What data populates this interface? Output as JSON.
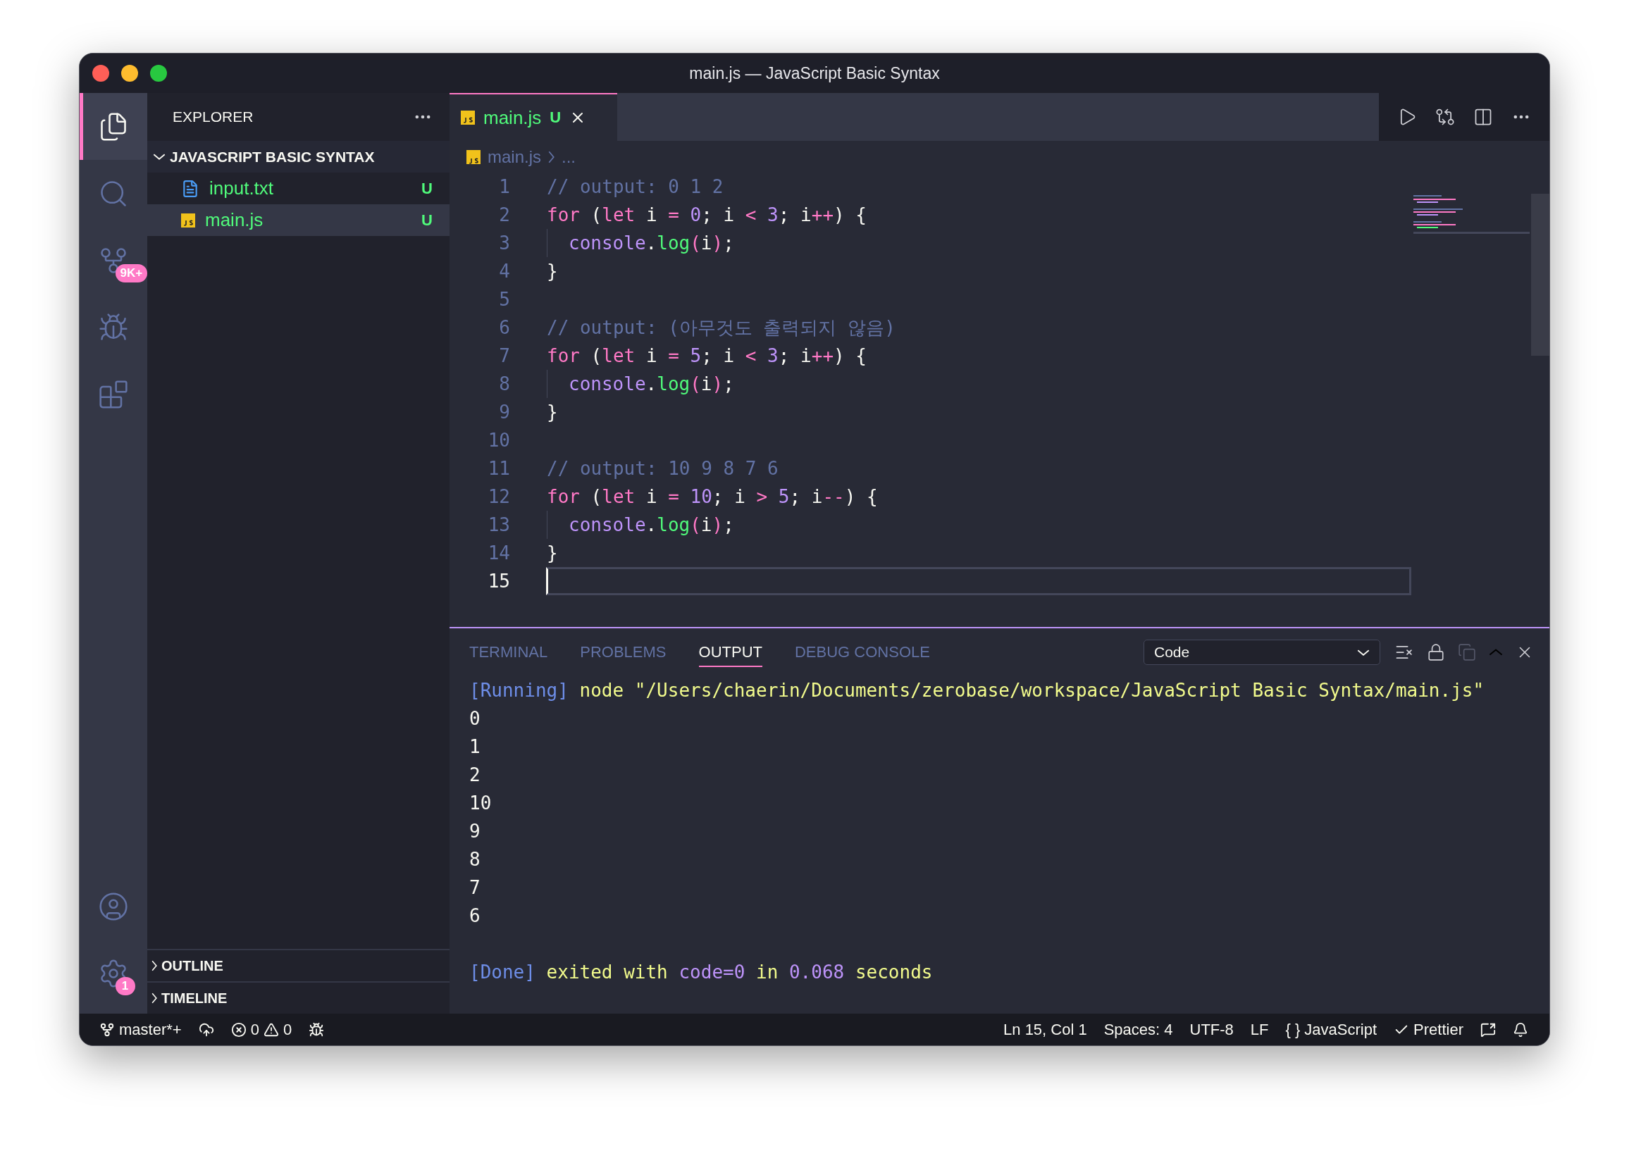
{
  "window": {
    "title": "main.js — JavaScript Basic Syntax"
  },
  "activity_bar": {
    "top": [
      {
        "kind": "files",
        "selected": true
      },
      {
        "kind": "search",
        "selected": false
      },
      {
        "kind": "source-control",
        "selected": false,
        "badge": "9K+"
      },
      {
        "kind": "run-debug",
        "selected": false
      },
      {
        "kind": "extensions",
        "selected": false
      }
    ],
    "bottom": [
      {
        "kind": "account",
        "selected": false
      },
      {
        "kind": "settings",
        "selected": false,
        "badge": "1"
      }
    ]
  },
  "sidebar": {
    "title": "EXPLORER",
    "folder": {
      "name": "JAVASCRIPT BASIC SYNTAX",
      "expanded": true,
      "files": [
        {
          "name": "input.txt",
          "kind": "text",
          "status": "U",
          "selected": false
        },
        {
          "name": "main.js",
          "kind": "js",
          "status": "U",
          "selected": true
        }
      ]
    },
    "sections": [
      {
        "name": "OUTLINE",
        "expanded": false
      },
      {
        "name": "TIMELINE",
        "expanded": false
      }
    ]
  },
  "tabs": [
    {
      "name": "main.js",
      "status": "U",
      "selected": true
    }
  ],
  "breadcrumb": {
    "file": "main.js",
    "rest": "..."
  },
  "code": [
    {
      "number": "1",
      "tokens": [
        {
          "t": "// output: 0 1 2",
          "kind": "comment"
        }
      ]
    },
    {
      "number": "2",
      "tokens": [
        {
          "t": "for",
          "kind": "keyword"
        },
        {
          "t": " (",
          "kind": "plain"
        },
        {
          "t": "let",
          "kind": "keyword"
        },
        {
          "t": " i ",
          "kind": "plain"
        },
        {
          "t": "=",
          "kind": "operator"
        },
        {
          "t": " 0",
          "kind": "number"
        },
        {
          "t": "; i ",
          "kind": "plain"
        },
        {
          "t": "<",
          "kind": "operator"
        },
        {
          "t": " 3",
          "kind": "number"
        },
        {
          "t": "; i",
          "kind": "plain"
        },
        {
          "t": "++",
          "kind": "operator"
        },
        {
          "t": ") {",
          "kind": "plain"
        }
      ]
    },
    {
      "number": "3",
      "indented": true,
      "tokens": [
        {
          "t": "console",
          "kind": "object"
        },
        {
          "t": ".",
          "kind": "plain"
        },
        {
          "t": "log",
          "kind": "function"
        },
        {
          "t": "(",
          "kind": "operator"
        },
        {
          "t": "i",
          "kind": "plain"
        },
        {
          "t": ")",
          "kind": "operator"
        },
        {
          "t": ";",
          "kind": "plain"
        }
      ]
    },
    {
      "number": "4",
      "tokens": [
        {
          "t": "}",
          "kind": "plain"
        }
      ]
    },
    {
      "number": "5"
    },
    {
      "number": "6",
      "tokens": [
        {
          "t": "// output: (아무것도 출력되지 않음)",
          "kind": "comment"
        }
      ]
    },
    {
      "number": "7",
      "tokens": [
        {
          "t": "for",
          "kind": "keyword"
        },
        {
          "t": " (",
          "kind": "plain"
        },
        {
          "t": "let",
          "kind": "keyword"
        },
        {
          "t": " i ",
          "kind": "plain"
        },
        {
          "t": "=",
          "kind": "operator"
        },
        {
          "t": " 5",
          "kind": "number"
        },
        {
          "t": "; i ",
          "kind": "plain"
        },
        {
          "t": "<",
          "kind": "operator"
        },
        {
          "t": " 3",
          "kind": "number"
        },
        {
          "t": "; i",
          "kind": "plain"
        },
        {
          "t": "++",
          "kind": "operator"
        },
        {
          "t": ") {",
          "kind": "plain"
        }
      ]
    },
    {
      "number": "8",
      "indented": true,
      "tokens": [
        {
          "t": "console",
          "kind": "object"
        },
        {
          "t": ".",
          "kind": "plain"
        },
        {
          "t": "log",
          "kind": "function"
        },
        {
          "t": "(",
          "kind": "operator"
        },
        {
          "t": "i",
          "kind": "plain"
        },
        {
          "t": ")",
          "kind": "operator"
        },
        {
          "t": ";",
          "kind": "plain"
        }
      ]
    },
    {
      "number": "9",
      "tokens": [
        {
          "t": "}",
          "kind": "plain"
        }
      ]
    },
    {
      "number": "10"
    },
    {
      "number": "11",
      "tokens": [
        {
          "t": "// output: 10 9 8 7 6",
          "kind": "comment"
        }
      ]
    },
    {
      "number": "12",
      "tokens": [
        {
          "t": "for",
          "kind": "keyword"
        },
        {
          "t": " (",
          "kind": "plain"
        },
        {
          "t": "let",
          "kind": "keyword"
        },
        {
          "t": " i ",
          "kind": "plain"
        },
        {
          "t": "=",
          "kind": "operator"
        },
        {
          "t": " 10",
          "kind": "number"
        },
        {
          "t": "; i ",
          "kind": "plain"
        },
        {
          "t": ">",
          "kind": "operator"
        },
        {
          "t": " 5",
          "kind": "number"
        },
        {
          "t": "; i",
          "kind": "plain"
        },
        {
          "t": "--",
          "kind": "operator"
        },
        {
          "t": ") {",
          "kind": "plain"
        }
      ]
    },
    {
      "number": "13",
      "indented": true,
      "tokens": [
        {
          "t": "console",
          "kind": "object"
        },
        {
          "t": ".",
          "kind": "plain"
        },
        {
          "t": "log",
          "kind": "function"
        },
        {
          "t": "(",
          "kind": "operator"
        },
        {
          "t": "i",
          "kind": "plain"
        },
        {
          "t": ")",
          "kind": "operator"
        },
        {
          "t": ";",
          "kind": "plain"
        }
      ]
    },
    {
      "number": "14",
      "tokens": [
        {
          "t": "}",
          "kind": "plain"
        }
      ]
    },
    {
      "number": "15",
      "current": true
    }
  ],
  "panel": {
    "tabs": [
      {
        "label": "TERMINAL",
        "selected": false
      },
      {
        "label": "PROBLEMS",
        "selected": false
      },
      {
        "label": "OUTPUT",
        "selected": true
      },
      {
        "label": "DEBUG CONSOLE",
        "selected": false
      }
    ],
    "channel": "Code",
    "output": [
      {
        "tokens": [
          {
            "t": "[Running]",
            "kind": "tag"
          },
          {
            "t": " node \"/Users/chaerin/Documents/zerobase/workspace/JavaScript Basic Syntax/main.js\"",
            "kind": "string"
          }
        ]
      },
      {
        "tokens": [
          {
            "t": "0",
            "kind": "plain"
          }
        ]
      },
      {
        "tokens": [
          {
            "t": "1",
            "kind": "plain"
          }
        ]
      },
      {
        "tokens": [
          {
            "t": "2",
            "kind": "plain"
          }
        ]
      },
      {
        "tokens": [
          {
            "t": "10",
            "kind": "plain"
          }
        ]
      },
      {
        "tokens": [
          {
            "t": "9",
            "kind": "plain"
          }
        ]
      },
      {
        "tokens": [
          {
            "t": "8",
            "kind": "plain"
          }
        ]
      },
      {
        "tokens": [
          {
            "t": "7",
            "kind": "plain"
          }
        ]
      },
      {
        "tokens": [
          {
            "t": "6",
            "kind": "plain"
          }
        ]
      },
      {
        "spaced": true,
        "tokens": [
          {
            "t": "[Done]",
            "kind": "tag"
          },
          {
            "t": " exited with ",
            "kind": "string"
          },
          {
            "t": "code=0",
            "kind": "number"
          },
          {
            "t": " in ",
            "kind": "string"
          },
          {
            "t": "0.068",
            "kind": "number"
          },
          {
            "t": " seconds",
            "kind": "string"
          }
        ]
      }
    ]
  },
  "status_bar": {
    "branch": "master*+",
    "errors": "0",
    "warnings": "0",
    "right": [
      {
        "kind": "plain",
        "text": "Ln 15, Col 1"
      },
      {
        "kind": "plain",
        "text": "Spaces: 4"
      },
      {
        "kind": "plain",
        "text": "UTF-8"
      },
      {
        "kind": "plain",
        "text": "LF"
      },
      {
        "kind": "language",
        "prefix": "{ }",
        "text": "JavaScript"
      },
      {
        "kind": "check",
        "text": "Prettier"
      }
    ]
  }
}
